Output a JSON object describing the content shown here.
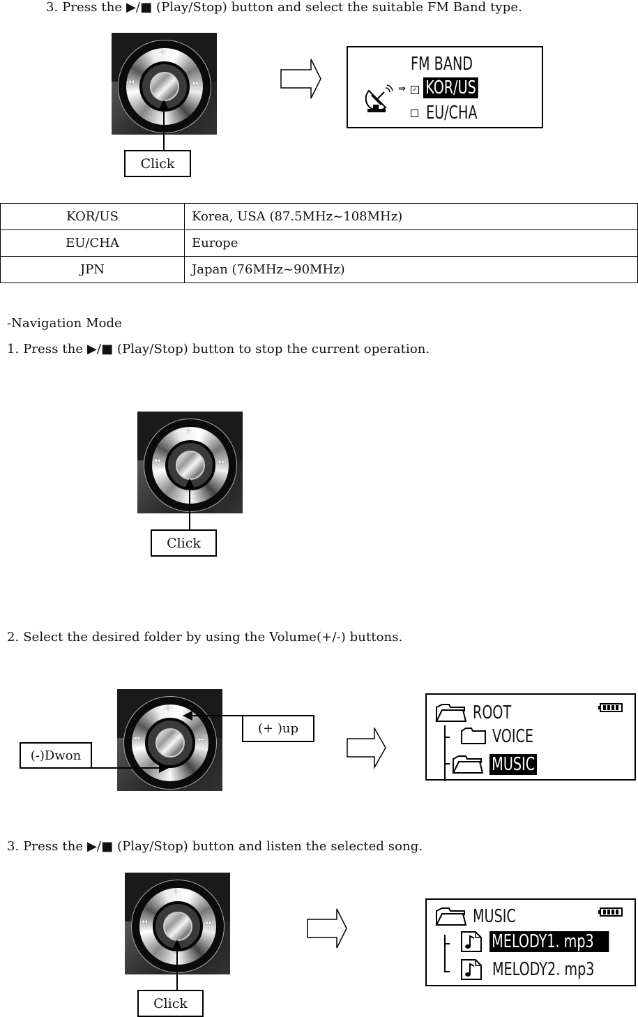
{
  "section_fm": {
    "step3_text": "3. Press the  ▶/■  (Play/Stop) button and select the suitable FM Band type.",
    "click_label": "Click",
    "lcd": {
      "title": "FM BAND",
      "cursor": "⇒",
      "options": [
        {
          "label": "KOR/US",
          "checked": true,
          "selected": true
        },
        {
          "label": "EU/CHA",
          "checked": false,
          "selected": false
        }
      ],
      "icon": "satellite-dish-icon"
    }
  },
  "band_table": {
    "rows": [
      {
        "band": "KOR/US",
        "description": "Korea, USA (87.5MHz~108MHz)"
      },
      {
        "band": "EU/CHA",
        "description": "Europe"
      },
      {
        "band": "JPN",
        "description": "Japan (76MHz~90MHz)"
      }
    ]
  },
  "navigation": {
    "heading": "-Navigation Mode",
    "step1_text": "1. Press the  ▶/■  (Play/Stop) button to stop the current operation.",
    "step1_click": "Click",
    "step2_text": "2. Select the desired folder by using the Volume(+/-) buttons.",
    "up_label": "(+ )up",
    "down_label": "(-)Dwon",
    "lcd_folders": {
      "root": "ROOT",
      "items": [
        {
          "label": "VOICE",
          "selected": false
        },
        {
          "label": "MUSIC",
          "selected": true
        }
      ],
      "battery": "full"
    },
    "step3_text": "3. Press the  ▶/■  (Play/Stop) button and listen the selected song.",
    "step3_click": "Click",
    "lcd_songs": {
      "folder": "MUSIC",
      "items": [
        {
          "label": "MELODY1. mp3",
          "selected": true
        },
        {
          "label": "MELODY2. mp3",
          "selected": false
        }
      ],
      "battery": "full"
    }
  },
  "wheel_glyphs": {
    "plus": "+",
    "minus": "−",
    "prev": "⏮",
    "next": "⏭"
  }
}
